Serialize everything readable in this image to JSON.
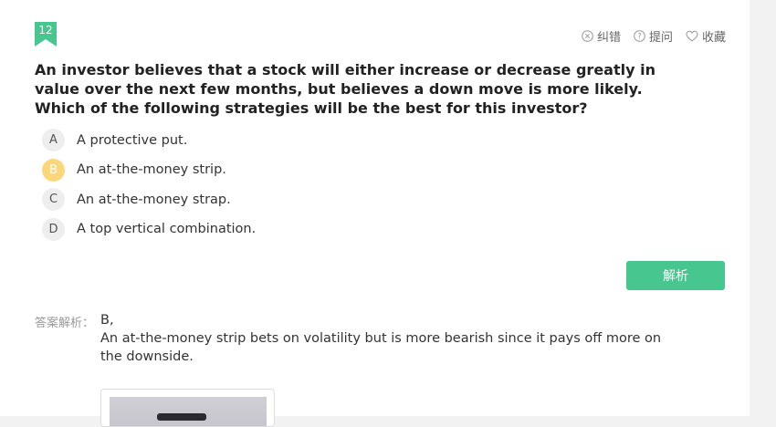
{
  "question": {
    "number": "12",
    "text": "An investor believes that a stock will either increase or decrease greatly in value over the next few months, but believes a down move is more likely. Which of the following strategies will be the best for this investor?"
  },
  "toolbar": {
    "report_error": {
      "label": "纠错",
      "icon": "close-circle-icon"
    },
    "ask_question": {
      "label": "提问",
      "icon": "question-circle-icon"
    },
    "favorite": {
      "label": "收藏",
      "icon": "heart-icon"
    }
  },
  "options": [
    {
      "letter": "A",
      "text": "A protective put.",
      "selected": false
    },
    {
      "letter": "B",
      "text": "An at-the-money strip.",
      "selected": true
    },
    {
      "letter": "C",
      "text": "An at-the-money strap.",
      "selected": false
    },
    {
      "letter": "D",
      "text": "A top vertical combination.",
      "selected": false
    }
  ],
  "analysis_button": {
    "label": "解析"
  },
  "answer": {
    "label": "答案解析：",
    "line1": "B,",
    "line2": "An at-the-money strip bets on volatility but is more bearish since it pays off more on the downside."
  },
  "colors": {
    "accent": "#47c690",
    "selected_option": "#fbd77c",
    "badge": "#47c690"
  }
}
